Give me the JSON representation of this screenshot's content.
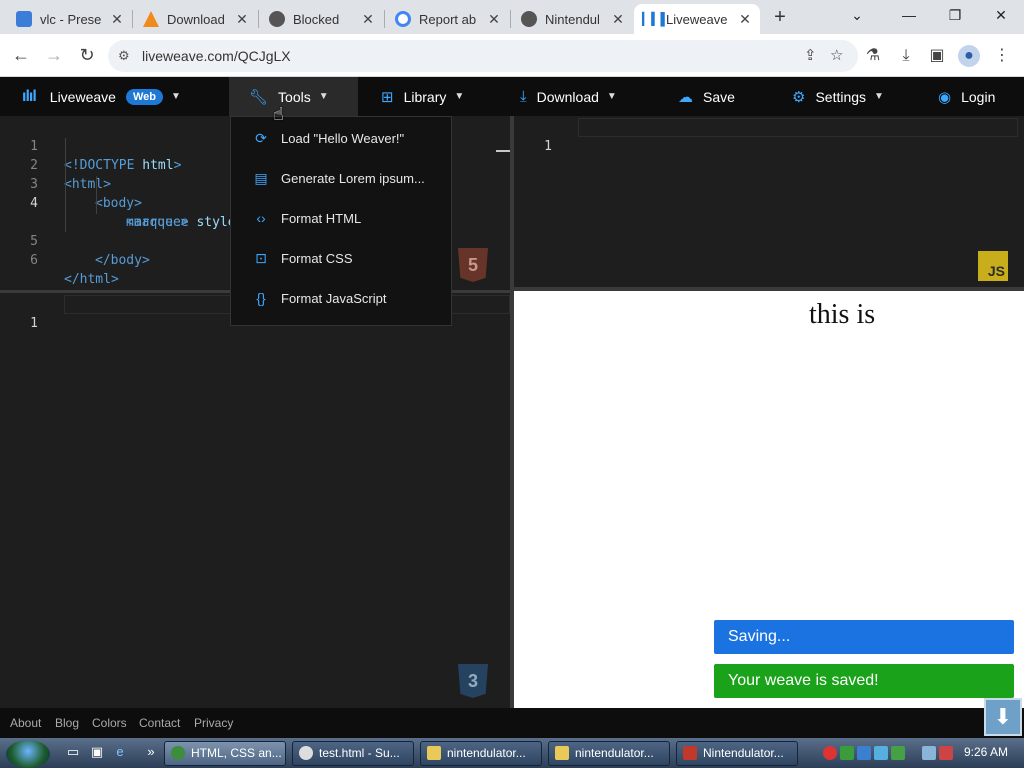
{
  "browser": {
    "tabs": [
      {
        "title": "vlc - Prese",
        "favicon_color": "#3b7dd8"
      },
      {
        "title": "Download",
        "favicon_color": "#f08a1c"
      },
      {
        "title": "Blocked",
        "favicon_color": "#555555"
      },
      {
        "title": "Report ab",
        "favicon_color": "#4285f4"
      },
      {
        "title": "Nintendul",
        "favicon_color": "#555555"
      },
      {
        "title": "Liveweave",
        "favicon_color": "#1d78d6",
        "active": true
      }
    ],
    "url": "liveweave.com/QCJgLX",
    "icons": [
      "back-icon",
      "forward-icon",
      "reload-icon",
      "site-info-icon",
      "share-icon",
      "star-icon",
      "labs-icon",
      "download-icon",
      "sidepanel-icon",
      "profile-icon",
      "menu-icon"
    ]
  },
  "app": {
    "brand": "Liveweave",
    "brand_badge": "Web",
    "menus": {
      "tools": "Tools",
      "library": "Library",
      "download": "Download",
      "save": "Save",
      "settings": "Settings",
      "login": "Login"
    },
    "tools_menu": [
      {
        "label": "Load \"Hello Weaver!\"",
        "icon": "load-icon"
      },
      {
        "label": "Generate Lorem ipsum...",
        "icon": "document-icon"
      },
      {
        "label": "Format HTML",
        "icon": "code-icon"
      },
      {
        "label": "Format CSS",
        "icon": "css-file-icon"
      },
      {
        "label": "Format JavaScript",
        "icon": "braces-icon"
      }
    ]
  },
  "editors": {
    "html": {
      "line_numbers": [
        "1",
        "2",
        "3",
        "4",
        "5",
        "6"
      ],
      "lines": {
        "l1_lt": "<!DOCTYPE ",
        "l1_kw": "html",
        "l1_gt": ">",
        "l2": "<html>",
        "l3": "<body>",
        "l4_tag": "<marquee ",
        "l4_attr": "style",
        "l4b": "marquee>",
        "l5": "</body>",
        "l6": "</html>"
      },
      "badge": "5"
    },
    "css": {
      "line_numbers": [
        "1"
      ],
      "badge": "3"
    },
    "js": {
      "line_numbers": [
        "1"
      ],
      "badge": "JS"
    }
  },
  "preview": {
    "text": "this is",
    "toasts": {
      "saving": "Saving...",
      "saved": "Your weave is saved!"
    },
    "colors": {
      "saving": "#1a73e0",
      "saved": "#1aa31a"
    }
  },
  "footer": {
    "links": [
      "About",
      "Blog",
      "Colors",
      "Contact",
      "Privacy"
    ]
  },
  "taskbar": {
    "tasks": [
      "HTML, CSS an...",
      "test.html - Su...",
      "nintendulator...",
      "nintendulator...",
      "Nintendulator..."
    ],
    "clock": "9:26 AM"
  }
}
